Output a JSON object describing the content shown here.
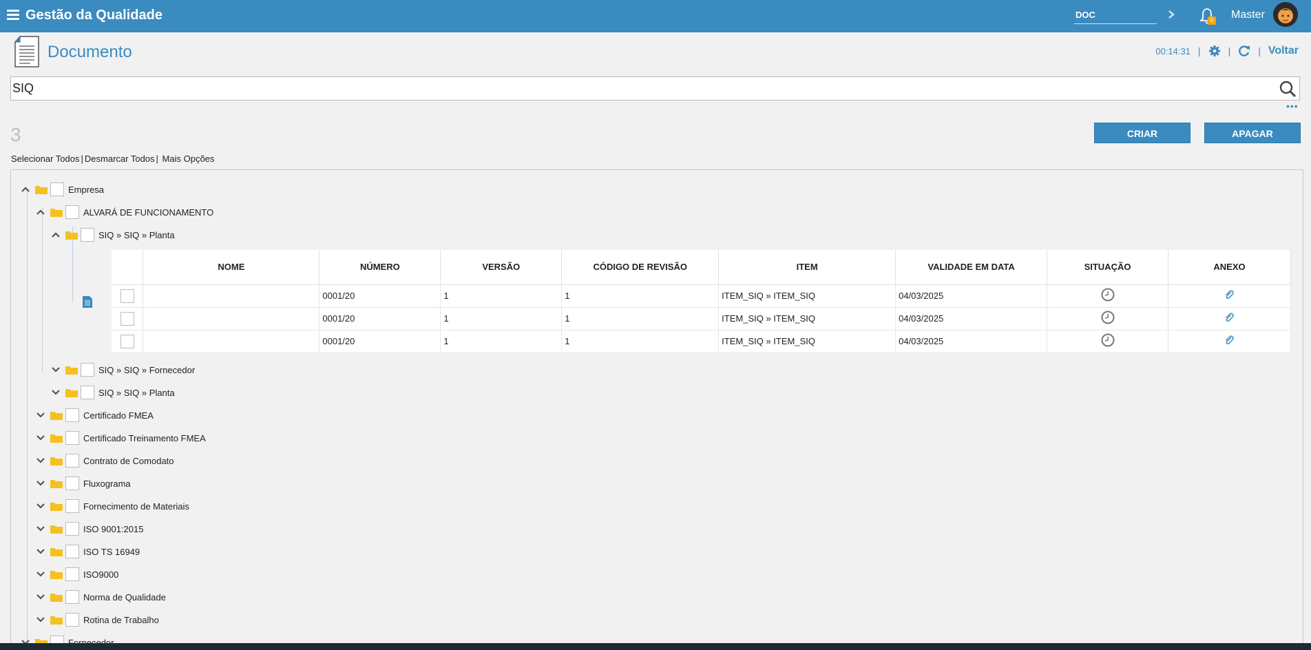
{
  "topbar": {
    "app_title": "Gestão da Qualidade",
    "module_value": "DOC",
    "notification_count": "0",
    "user_name": "Master"
  },
  "header": {
    "title": "Documento",
    "timer": "00:14:31",
    "back_label": "Voltar"
  },
  "search": {
    "value": "SIQ"
  },
  "toolbar": {
    "count": "3",
    "create_label": "CRIAR",
    "delete_label": "APAGAR",
    "select_all": "Selecionar Todos",
    "deselect_all": "Desmarcar Todos",
    "more_options": "Mais Opções"
  },
  "tree": {
    "root": "Empresa",
    "level1_open": "ALVARÁ DE FUNCIONAMENTO",
    "level2_open": "SIQ » SIQ » Planta",
    "level2_b": "SIQ » SIQ » Fornecedor",
    "level2_c": "SIQ » SIQ » Planta",
    "level1_items": [
      "Certificado FMEA",
      "Certificado Treinamento FMEA",
      "Contrato de Comodato",
      "Fluxograma",
      "Fornecimento de Materiais",
      "ISO 9001:2015",
      "ISO TS 16949",
      "ISO9000",
      "Norma de Qualidade",
      "Rotina de Trabalho"
    ],
    "next_root": "Fornecedor"
  },
  "grid": {
    "columns": [
      "NOME",
      "NÚMERO",
      "VERSÃO",
      "CÓDIGO DE REVISÃO",
      "ITEM",
      "VALIDADE EM DATA",
      "SITUAÇÃO",
      "ANEXO"
    ],
    "rows": [
      {
        "nome": "",
        "numero": "0001/20",
        "versao": "1",
        "codigo": "1",
        "item": "ITEM_SIQ » ITEM_SIQ",
        "validade": "04/03/2025",
        "situacao_icon": "clock-icon",
        "anexo_icon": "paperclip-icon"
      },
      {
        "nome": "",
        "numero": "0001/20",
        "versao": "1",
        "codigo": "1",
        "item": "ITEM_SIQ » ITEM_SIQ",
        "validade": "04/03/2025",
        "situacao_icon": "clock-icon",
        "anexo_icon": "paperclip-icon"
      },
      {
        "nome": "",
        "numero": "0001/20",
        "versao": "1",
        "codigo": "1",
        "item": "ITEM_SIQ » ITEM_SIQ",
        "validade": "04/03/2025",
        "situacao_icon": "clock-icon",
        "anexo_icon": "paperclip-icon"
      }
    ]
  },
  "colors": {
    "primary": "#3a8bbf",
    "folder": "#f5c120",
    "background": "#f1f1f1"
  }
}
